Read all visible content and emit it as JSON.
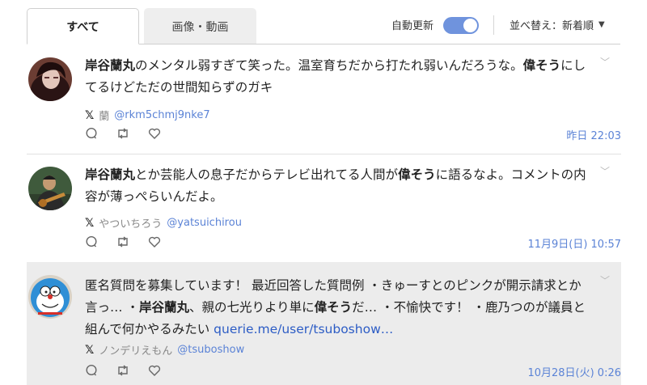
{
  "tabs": {
    "all": "すべて",
    "media": "画像・動画"
  },
  "controls": {
    "auto_refresh_label": "自動更新",
    "auto_refresh_on": true,
    "sort_label": "並べ替え：新着順"
  },
  "colors": {
    "accent": "#6f93dd",
    "link": "#2c5cc5",
    "meta": "#5b83d6",
    "highlight_bg": "#ececec"
  },
  "posts": [
    {
      "text_parts": [
        {
          "t": "岸谷蘭丸",
          "bold": true
        },
        {
          "t": "のメンタル弱すぎて笑った。温室育ちだから打たれ弱いんだろうな。"
        },
        {
          "t": "偉そう",
          "bold": true
        },
        {
          "t": "にしてるけどただの世間知らずのガキ"
        }
      ],
      "display_name": "蘭",
      "user_id": "@rkm5chmj9nke7",
      "timestamp": "昨日 22:03"
    },
    {
      "text_parts": [
        {
          "t": "岸谷蘭丸",
          "bold": true
        },
        {
          "t": "とか芸能人の息子だからテレビ出れてる人間が"
        },
        {
          "t": "偉そう",
          "bold": true
        },
        {
          "t": "に語るなよ。コメントの内容が薄っぺらいんだよ。"
        }
      ],
      "display_name": "やついちろう",
      "user_id": "@yatsuichirou",
      "timestamp": "11月9日(日) 10:57"
    },
    {
      "text_parts": [
        {
          "t": "匿名質問を募集しています！ 最近回答した質問例 ・きゅーすとのピンクが開示請求とか言っ… ・"
        },
        {
          "t": "岸谷蘭丸",
          "bold": true
        },
        {
          "t": "、親の七光りより単に"
        },
        {
          "t": "偉そう",
          "bold": true
        },
        {
          "t": "だ… ・不愉快です！ ・鹿乃つのが議員と組んで何かやるみたい "
        },
        {
          "t": "querie.me/user/tsuboshow…",
          "link": true
        }
      ],
      "display_name": "ノンデリえもん",
      "user_id": "@tsuboshow",
      "timestamp": "10月28日(火) 0:26"
    }
  ]
}
